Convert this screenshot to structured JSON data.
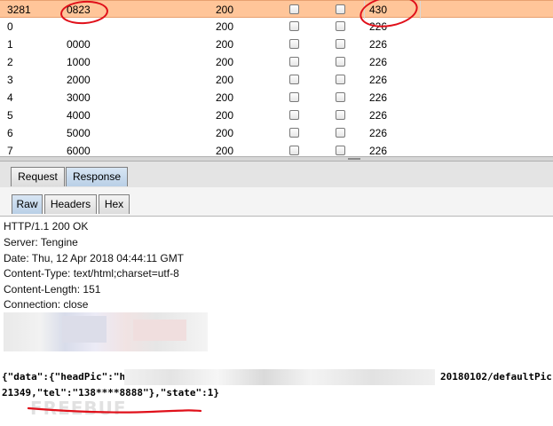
{
  "results": {
    "rows": [
      {
        "num": "3281",
        "payload": "0823",
        "status": "200",
        "length": "430",
        "selected": true
      },
      {
        "num": "0",
        "payload": "",
        "status": "200",
        "length": "226"
      },
      {
        "num": "1",
        "payload": "0000",
        "status": "200",
        "length": "226"
      },
      {
        "num": "2",
        "payload": "1000",
        "status": "200",
        "length": "226"
      },
      {
        "num": "3",
        "payload": "2000",
        "status": "200",
        "length": "226"
      },
      {
        "num": "4",
        "payload": "3000",
        "status": "200",
        "length": "226"
      },
      {
        "num": "5",
        "payload": "4000",
        "status": "200",
        "length": "226"
      },
      {
        "num": "6",
        "payload": "5000",
        "status": "200",
        "length": "226"
      },
      {
        "num": "7",
        "payload": "6000",
        "status": "200",
        "length": "226"
      }
    ]
  },
  "tabs": {
    "request": "Request",
    "response": "Response"
  },
  "view_tabs": {
    "raw": "Raw",
    "headers": "Headers",
    "hex": "Hex"
  },
  "response": {
    "headers": [
      "HTTP/1.1 200 OK",
      "Server: Tengine",
      "Date: Thu, 12 Apr 2018 04:44:11 GMT",
      "Content-Type: text/html;charset=utf-8",
      "Content-Length: 151",
      "Connection: close"
    ],
    "body_line1_start": "{\"data\":{\"headPic\":\"h",
    "body_line1_end": "20180102/defaultPic",
    "body_line2": "21349,\"tel\":\"138****8888\"},\"state\":1}",
    "watermark": "FREEBUF"
  },
  "colors": {
    "selected_row": "#ffc599",
    "annotation": "#e0101a",
    "active_tab": "#c5d8ec"
  }
}
